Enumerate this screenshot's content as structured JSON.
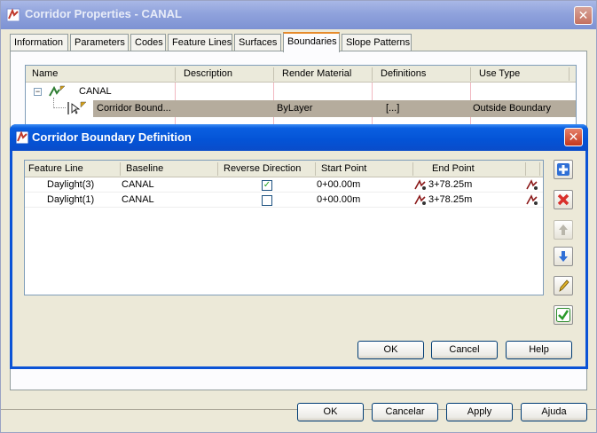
{
  "outer": {
    "title": "Corridor Properties - CANAL",
    "tabs": [
      "Information",
      "Parameters",
      "Codes",
      "Feature Lines",
      "Surfaces",
      "Boundaries",
      "Slope Patterns"
    ],
    "active_tab": "Boundaries",
    "columns": [
      "Name",
      "Description",
      "Render Material",
      "Definitions",
      "Use Type"
    ],
    "tree": {
      "root": "CANAL",
      "child": {
        "name": "Corridor Bound...",
        "render_material": "ByLayer",
        "definitions": "[...]",
        "use_type": "Outside Boundary"
      }
    },
    "buttons": {
      "ok": "OK",
      "cancel": "Cancelar",
      "apply": "Apply",
      "help": "Ajuda"
    }
  },
  "dialog": {
    "title": "Corridor Boundary Definition",
    "columns": [
      "Feature Line",
      "Baseline",
      "Reverse Direction",
      "Start Point",
      "End Point"
    ],
    "rows": [
      {
        "feature_line": "Daylight(3)",
        "baseline": "CANAL",
        "reverse": true,
        "start": "0+00.00m",
        "end": "3+78.25m"
      },
      {
        "feature_line": "Daylight(1)",
        "baseline": "CANAL",
        "reverse": false,
        "start": "0+00.00m",
        "end": "3+78.25m"
      }
    ],
    "buttons": {
      "ok": "OK",
      "cancel": "Cancel",
      "help": "Help"
    }
  },
  "colors": {
    "dialog_title": "#0453d6",
    "outer_title_inactive": "#8fa2dc",
    "active_tab_accent": "#e68b2c",
    "selection": "#b5ac9d"
  }
}
